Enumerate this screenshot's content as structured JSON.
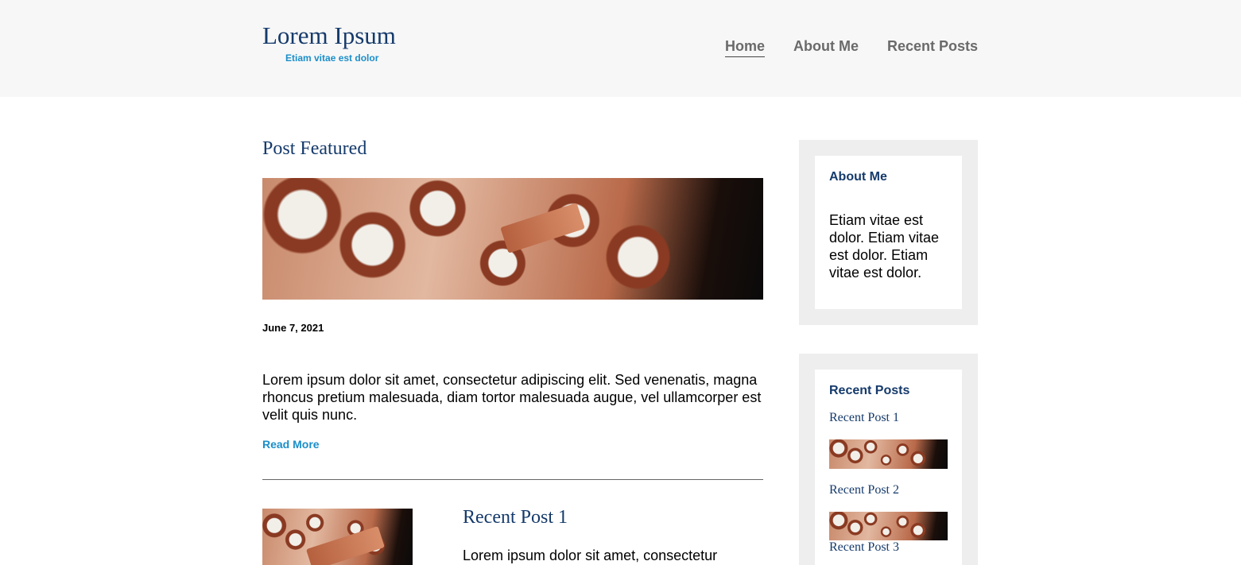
{
  "header": {
    "site_title": "Lorem Ipsum",
    "tagline": "Etiam vitae est dolor",
    "nav": [
      {
        "label": "Home",
        "active": true
      },
      {
        "label": "About Me",
        "active": false
      },
      {
        "label": "Recent Posts",
        "active": false
      }
    ]
  },
  "featured": {
    "section_title": "Post Featured",
    "image": "keyboard-photo",
    "date": "June 7, 2021",
    "excerpt": "Lorem ipsum dolor sit amet, consectetur adipiscing elit. Sed venenatis, magna rhoncus pretium malesuada, diam tortor malesuada augue, vel ullamcorper est velit quis nunc.",
    "read_more": "Read More"
  },
  "recent_main": {
    "title": "Recent Post 1",
    "excerpt": "Lorem ipsum dolor sit amet, consectetur"
  },
  "sidebar": {
    "about": {
      "heading": "About Me",
      "text": "Etiam vitae est dolor. Etiam vitae est dolor. Etiam vitae est dolor."
    },
    "recent": {
      "heading": "Recent Posts",
      "items": [
        {
          "label": "Recent Post 1"
        },
        {
          "label": "Recent Post 2"
        },
        {
          "label": "Recent Post 3"
        }
      ]
    }
  },
  "colors": {
    "heading_navy": "#153a6b",
    "accent_blue": "#1b8ec9",
    "header_bg": "#f7f7f7",
    "widget_bg": "#eeeeee"
  }
}
